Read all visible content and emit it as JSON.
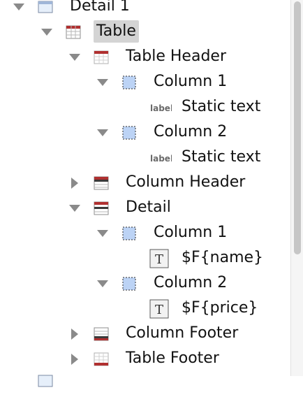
{
  "tree": {
    "items": [
      {
        "label": "Detail 1",
        "icon": "band-icon",
        "expanded": true
      },
      {
        "label": "Table",
        "icon": "table-icon",
        "expanded": true,
        "selected": true
      },
      {
        "label": "Table Header",
        "icon": "table-header-icon",
        "expanded": true
      },
      {
        "label": "Column 1",
        "icon": "column-icon",
        "expanded": true
      },
      {
        "label": "Static text",
        "icon": "static-text-icon",
        "badge": "label"
      },
      {
        "label": "Column 2",
        "icon": "column-icon",
        "expanded": true
      },
      {
        "label": "Static text",
        "icon": "static-text-icon",
        "badge": "label"
      },
      {
        "label": "Column Header",
        "icon": "column-header-icon",
        "expanded": false
      },
      {
        "label": "Detail",
        "icon": "detail-icon",
        "expanded": true
      },
      {
        "label": "Column 1",
        "icon": "column-icon",
        "expanded": true
      },
      {
        "label": "$F{name}",
        "icon": "text-field-icon",
        "badge": "T"
      },
      {
        "label": "Column 2",
        "icon": "column-icon",
        "expanded": true
      },
      {
        "label": "$F{price}",
        "icon": "text-field-icon",
        "badge": "T"
      },
      {
        "label": "Column Footer",
        "icon": "column-footer-icon",
        "expanded": false
      },
      {
        "label": "Table Footer",
        "icon": "table-footer-icon",
        "expanded": false
      }
    ]
  },
  "colors": {
    "selection": "#d4d4d4",
    "band_red": "#b03030",
    "column_blue": "#bcd3f5",
    "arrow_gray": "#8a8a8a"
  }
}
